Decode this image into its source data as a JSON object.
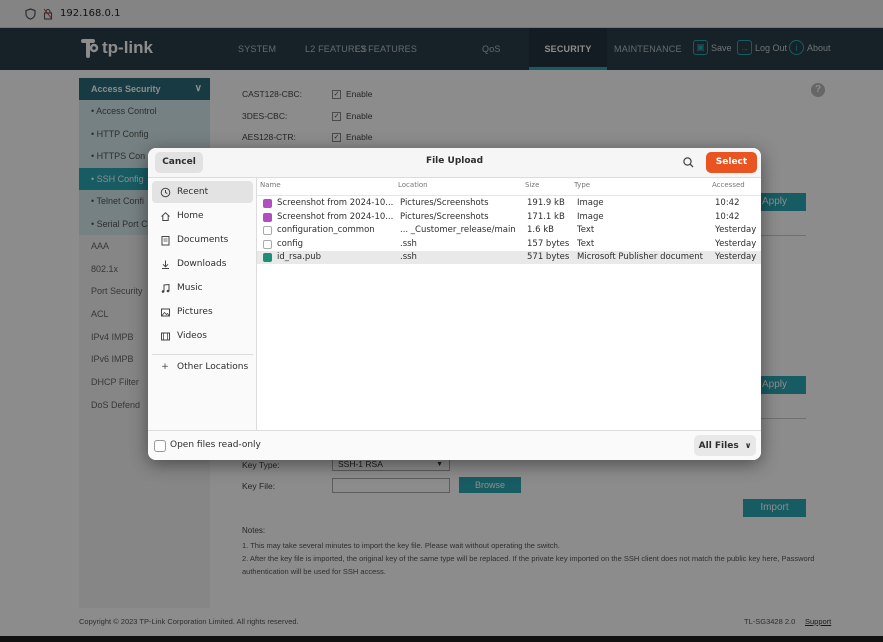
{
  "browser": {
    "url": "192.168.0.1"
  },
  "app": {
    "logo_text": "tp-link",
    "nav": [
      {
        "label": "SYSTEM"
      },
      {
        "label": "L2 FEATURES"
      },
      {
        "label": "L3 FEATURES"
      },
      {
        "label": "QoS"
      },
      {
        "label": "SECURITY"
      },
      {
        "label": "MAINTENANCE"
      }
    ],
    "actions": {
      "save": "Save",
      "logout": "Log Out",
      "about": "About"
    },
    "sidebar": {
      "header": "Access Security",
      "sub_items": [
        {
          "label": "Access Control"
        },
        {
          "label": "HTTP Config"
        },
        {
          "label": "HTTPS Con"
        },
        {
          "label": "SSH Config"
        },
        {
          "label": "Telnet Confi"
        },
        {
          "label": "Serial Port C"
        }
      ],
      "items": [
        {
          "label": "AAA"
        },
        {
          "label": "802.1x"
        },
        {
          "label": "Port Security"
        },
        {
          "label": "ACL"
        },
        {
          "label": "IPv4 IMPB"
        },
        {
          "label": "IPv6 IMPB"
        },
        {
          "label": "DHCP Filter"
        },
        {
          "label": "DoS Defend"
        }
      ]
    },
    "content": {
      "ciphers": [
        {
          "name": "CAST128-CBC:",
          "state": "Enable"
        },
        {
          "name": "3DES-CBC:",
          "state": "Enable"
        },
        {
          "name": "AES128-CTR:",
          "state": "Enable"
        }
      ],
      "apply_label": "Apply",
      "key_type_label": "Key Type:",
      "key_type_value": "SSH-1 RSA",
      "key_file_label": "Key File:",
      "browse_label": "Browse",
      "import_label": "Import",
      "notes_title": "Notes:",
      "note_1": "1. This may take several minutes to import the key file. Please wait without operating the switch.",
      "note_2": "2. After the key file is imported, the original key of the same type will be replaced. If the private key imported on the SSH client does not match the public key here, Password authentication will be used for SSH access."
    },
    "footer": {
      "copyright": "Copyright © 2023    TP-Link Corporation Limited. All rights reserved.",
      "model": "TL-SG3428 2.0",
      "support": "Support"
    }
  },
  "dialog": {
    "title": "File Upload",
    "cancel": "Cancel",
    "select": "Select",
    "places": [
      {
        "label": "Recent",
        "icon": "clock-icon"
      },
      {
        "label": "Home",
        "icon": "home-icon"
      },
      {
        "label": "Documents",
        "icon": "documents-icon"
      },
      {
        "label": "Downloads",
        "icon": "download-icon"
      },
      {
        "label": "Music",
        "icon": "music-icon"
      },
      {
        "label": "Pictures",
        "icon": "pictures-icon"
      },
      {
        "label": "Videos",
        "icon": "videos-icon"
      },
      {
        "label": "Other Locations",
        "icon": "plus-icon"
      }
    ],
    "columns": {
      "name": "Name",
      "location": "Location",
      "size": "Size",
      "type": "Type",
      "accessed": "Accessed"
    },
    "files": [
      {
        "name": "Screenshot from 2024-10...",
        "location": "Pictures/Screenshots",
        "size": "191.9 kB",
        "type": "Image",
        "accessed": "10:42",
        "icon": "image-file-icon"
      },
      {
        "name": "Screenshot from 2024-10...",
        "location": "Pictures/Screenshots",
        "size": "171.1 kB",
        "type": "Image",
        "accessed": "10:42",
        "icon": "image-file-icon"
      },
      {
        "name": "configuration_common",
        "location": "... _Customer_release/main",
        "size": "1.6 kB",
        "type": "Text",
        "accessed": "Yesterday",
        "icon": "text-file-icon"
      },
      {
        "name": "config",
        "location": ".ssh",
        "size": "157 bytes",
        "type": "Text",
        "accessed": "Yesterday",
        "icon": "text-file-icon"
      },
      {
        "name": "id_rsa.pub",
        "location": ".ssh",
        "size": "571 bytes",
        "type": "Microsoft Publisher document",
        "accessed": "Yesterday",
        "icon": "publisher-file-icon"
      }
    ],
    "read_only_label": "Open files read-only",
    "filter_label": "All Files"
  }
}
